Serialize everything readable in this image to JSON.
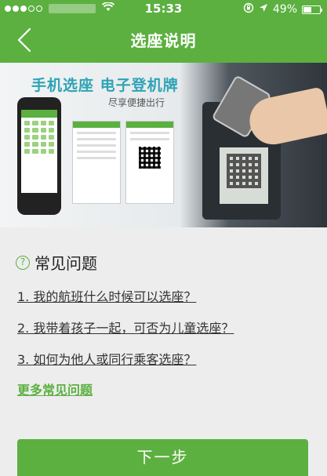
{
  "status_bar": {
    "time": "15:33",
    "battery_text": "49%",
    "battery_level": 0.49,
    "wifi_icon": "wifi-icon",
    "rotation_lock_icon": "rotation-lock-icon",
    "location_icon": "location-arrow-icon"
  },
  "nav": {
    "title": "选座说明",
    "back_icon": "chevron-left-icon"
  },
  "banner": {
    "headline": "手机选座  电子登机牌",
    "subtitle": "尽享便捷出行"
  },
  "faq": {
    "title": "常见问题",
    "icon": "question-circle-icon",
    "items": [
      {
        "label": "1. 我的航班什么时候可以选座？"
      },
      {
        "label": "2. 我带着孩子一起，可否为儿童选座？"
      },
      {
        "label": "3. 如何为他人或同行乘客选座？"
      }
    ],
    "more_label": "更多常见问题"
  },
  "next_button": {
    "label": "下一步"
  },
  "colors": {
    "accent": "#5cb040",
    "background": "#ededed"
  }
}
